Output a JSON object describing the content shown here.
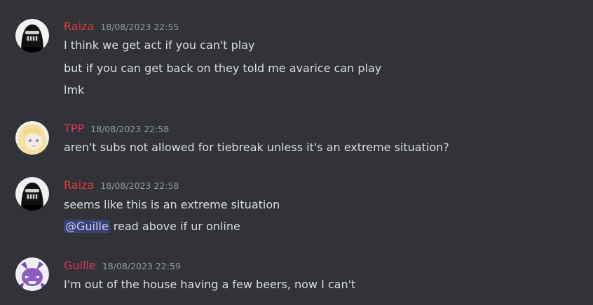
{
  "colors": {
    "background": "#313338",
    "raiza_name": "#e23c3c",
    "tpp_name": "#e0325e",
    "guille_name": "#e0325e",
    "timestamp": "#949ba4",
    "text": "#dbdee1",
    "mention_bg": "#3c4270"
  },
  "messages": [
    {
      "author": "Raiza",
      "timestamp": "18/08/2023 22:55",
      "avatar_icon": "masked-face-avatar-icon",
      "lines": [
        "I think we get act if you can't play",
        "but if you can get back on they told me avarice can play",
        "lmk"
      ]
    },
    {
      "author": "TPP",
      "timestamp": "18/08/2023 22:58",
      "avatar_icon": "anime-girl-avatar-icon",
      "lines": [
        "aren't subs not allowed for tiebreak unless it's an extreme situation?"
      ]
    },
    {
      "author": "Raiza",
      "timestamp": "18/08/2023 22:58",
      "avatar_icon": "masked-face-avatar-icon",
      "lines": [
        "seems like this is an extreme situation"
      ],
      "mention_line": {
        "mention": "@Guille",
        "text": " read above if ur online"
      }
    },
    {
      "author": "Guille",
      "timestamp": "18/08/2023 22:59",
      "avatar_icon": "purple-creature-avatar-icon",
      "lines": [
        "I'm out of the house having a few beers, now I can't"
      ]
    }
  ]
}
